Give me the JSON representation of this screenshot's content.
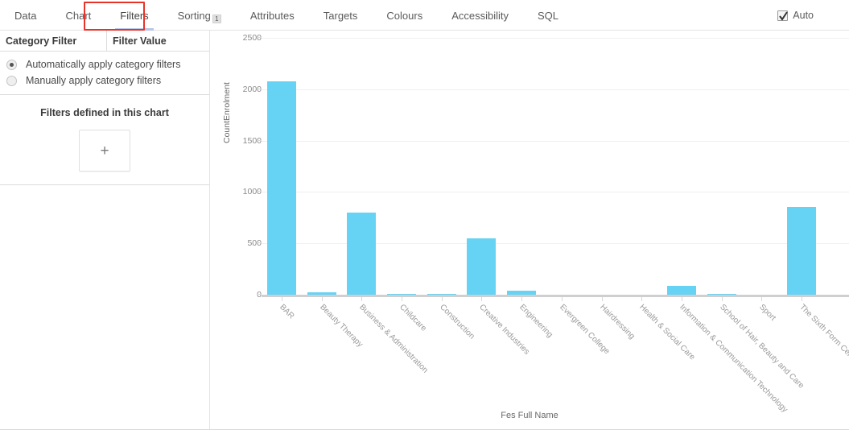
{
  "tabs": [
    {
      "label": "Data",
      "active": false,
      "badge": null
    },
    {
      "label": "Chart",
      "active": false,
      "badge": null
    },
    {
      "label": "Filters",
      "active": true,
      "badge": null
    },
    {
      "label": "Sorting",
      "active": false,
      "badge": "1"
    },
    {
      "label": "Attributes",
      "active": false,
      "badge": null
    },
    {
      "label": "Targets",
      "active": false,
      "badge": null
    },
    {
      "label": "Colours",
      "active": false,
      "badge": null
    },
    {
      "label": "Accessibility",
      "active": false,
      "badge": null
    },
    {
      "label": "SQL",
      "active": false,
      "badge": null
    }
  ],
  "toolbar": {
    "auto_label": "Auto",
    "auto_checked": true
  },
  "annotation": {
    "highlight_colour": "#e8332a",
    "highlight_target": "Filters"
  },
  "filter_panel": {
    "columns": [
      "Category Filter",
      "Filter Value"
    ],
    "radio_options": [
      {
        "label": "Automatically apply category filters",
        "selected": true
      },
      {
        "label": "Manually apply category filters",
        "selected": false
      }
    ],
    "defined_title": "Filters defined in this chart",
    "add_button_glyph": "+"
  },
  "chart_data": {
    "type": "bar",
    "title": "",
    "xlabel": "Fes Full Name",
    "ylabel": "CountEnrolment",
    "ylim": [
      0,
      2500
    ],
    "yticks": [
      0,
      500,
      1000,
      1500,
      2000,
      2500
    ],
    "grid": true,
    "legend": null,
    "bar_colour": "#67d3f4",
    "categories": [
      "BAR",
      "Beauty Therapy",
      "Business & Administration",
      "Childcare",
      "Construction",
      "Creative Industries",
      "Engineering",
      "Evergreen College",
      "Hairdressing",
      "Health & Social Care",
      "Information & Communication Technology",
      "School of Hair, Beauty and Care",
      "Sport",
      "The Sixth Form Centre"
    ],
    "values": [
      2075,
      20,
      800,
      8,
      5,
      545,
      40,
      0,
      0,
      0,
      85,
      10,
      0,
      855
    ]
  }
}
